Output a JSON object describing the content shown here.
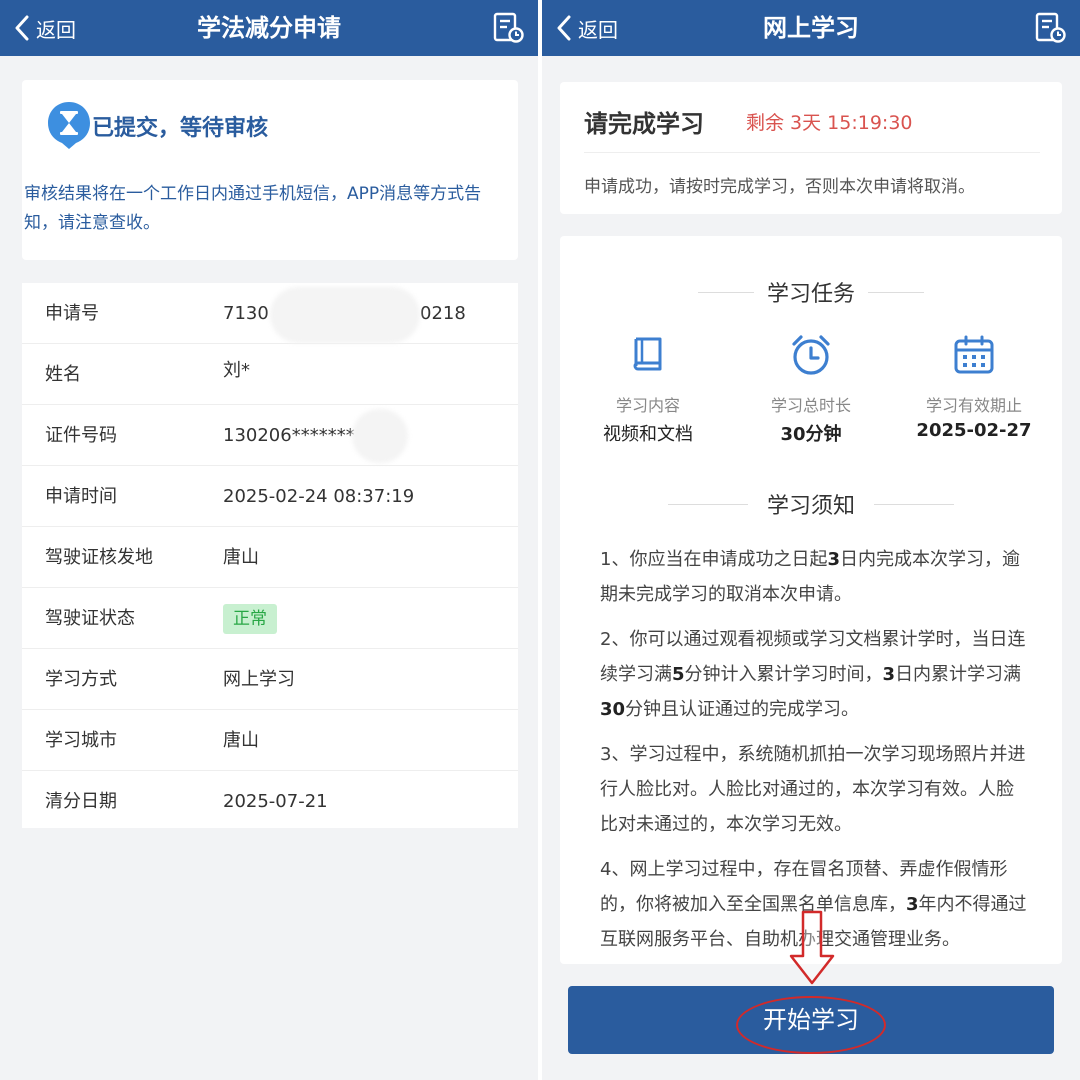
{
  "left": {
    "header": {
      "back_label": "返回",
      "title": "学法减分申请"
    },
    "status": {
      "title": "已提交，等待审核",
      "description": "审核结果将在一个工作日内通过手机短信，APP消息等方式告知，请注意查收。"
    },
    "rows": [
      {
        "label": "申请号",
        "value": "7130",
        "value_tail": "0218"
      },
      {
        "label": "姓名",
        "value": "刘*"
      },
      {
        "label": "证件号码",
        "value": "130206*******"
      },
      {
        "label": "申请时间",
        "value": "2025-02-24 08:37:19"
      },
      {
        "label": "驾驶证核发地",
        "value": "唐山"
      },
      {
        "label": "驾驶证状态",
        "value": "正常"
      },
      {
        "label": "学习方式",
        "value": "网上学习"
      },
      {
        "label": "学习城市",
        "value": "唐山"
      },
      {
        "label": "清分日期",
        "value": "2025-07-21"
      }
    ]
  },
  "right": {
    "header": {
      "back_label": "返回",
      "title": "网上学习"
    },
    "task_head": {
      "title": "请完成学习",
      "countdown": "剩余 3天 15:19:30",
      "description": "申请成功，请按时完成学习，否则本次申请将取消。"
    },
    "tasks": {
      "heading": "学习任务",
      "items": [
        {
          "label": "学习内容",
          "value": "视频和文档"
        },
        {
          "label": "学习总时长",
          "value": "30分钟"
        },
        {
          "label": "学习有效期止",
          "value": "2025-02-27"
        }
      ]
    },
    "notice": {
      "heading": "学习须知",
      "items": [
        {
          "a": "1、你应当在申请成功之日起",
          "b": "3",
          "c": "日内完成本次学习，逾期未完成学习的取消本次申请。"
        },
        {
          "a": "2、你可以通过观看视频或学习文档累计学时，当日连续学习满",
          "b": "5",
          "c": "分钟计入累计学习时间，",
          "d": "3",
          "e": "日内累计学习满",
          "f": "30",
          "g": "分钟且认证通过的完成学习。"
        },
        {
          "a": "3、学习过程中，系统随机抓拍一次学习现场照片并进行人脸比对。人脸比对通过的，本次学习有效。人脸比对未通过的，本次学习无效。"
        },
        {
          "a": "4、网上学习过程中，存在冒名顶替、弄虚作假情形的，你将被加入至全国黑名单信息库，",
          "b": "3",
          "c": "年内不得通过互联网服务平台、自助机办理交通管理业务。"
        }
      ]
    },
    "start_button": "开始学习"
  },
  "colors": {
    "header_blue": "#2a5c9e",
    "countdown_red": "#d9534f",
    "status_green": "#28a745",
    "annotation_red": "#d22a2a"
  },
  "icons": [
    "chevron-left-icon",
    "history-doc-icon",
    "hourglass-icon",
    "book-icon",
    "alarm-clock-icon",
    "calendar-icon",
    "down-arrow-icon"
  ]
}
